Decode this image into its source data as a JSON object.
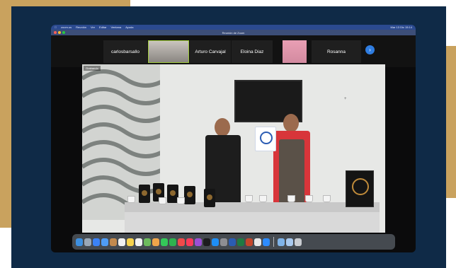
{
  "menubar": {
    "apple": "",
    "items": [
      "zoom.us",
      "Reunión",
      "Ver",
      "Editar",
      "Ventana",
      "Ayuda"
    ],
    "right_text": "Mar 13 Dic 15:14"
  },
  "window": {
    "title": "Reunión de Zoom"
  },
  "participants": [
    {
      "name": "carlosbarsallo"
    },
    {
      "name": ""
    },
    {
      "name": "Arturo Carvajal"
    },
    {
      "name": "Eloina Diaz"
    },
    {
      "name": ""
    },
    {
      "name": "Rosanna"
    }
  ],
  "next_icon": "chevron-right-icon",
  "video": {
    "rec_label": "Grabando"
  },
  "colors": {
    "gold": "#c9a25e",
    "navy": "#0f2a47",
    "active_border": "#9ec93a",
    "menubar": "#2b4a8f",
    "next_button": "#2f7de1"
  },
  "dock": {
    "left_apps": [
      "finder-icon",
      "launchpad-icon",
      "safari-icon",
      "mail-icon",
      "contacts-icon",
      "calendar-icon",
      "notes-icon",
      "reminders-icon",
      "maps-icon",
      "photos-icon",
      "messages-icon",
      "facetime-icon",
      "news-icon",
      "music-icon",
      "podcasts-icon",
      "tv-icon",
      "appstore-icon",
      "settings-icon",
      "word-icon",
      "excel-icon",
      "powerpoint-icon",
      "chrome-icon",
      "zoom-icon"
    ],
    "right_apps": [
      "folder-icon",
      "downloads-icon",
      "trash-icon"
    ]
  }
}
